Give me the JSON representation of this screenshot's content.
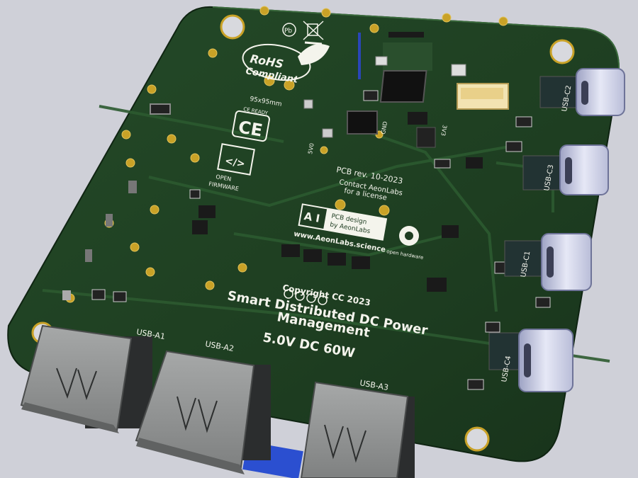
{
  "board": {
    "title_line1": "Smart Distributed DC Power",
    "title_line2": "Management",
    "rating": "5.0V DC 60W",
    "copyright": "Copyright CC 2023",
    "revision": "PCB rev. 10-2023",
    "contact_line1": "Contact AeonLabs",
    "contact_line2": "for a license",
    "size": "95x95mm",
    "rohs_line1": "RoHS",
    "rohs_line2": "Compliant",
    "ce_ready": "CE READY",
    "ce_mark": "CE",
    "open_firmware_line1": "OPEN",
    "open_firmware_line2": "FIRMWARE",
    "logo_letters": "A I",
    "design_line1": "PCB design",
    "design_line2": "by AeonLabs",
    "website": "www.AeonLabs.science",
    "open_hardware": "open hardware",
    "pb_mark": "Pb"
  },
  "connectors": {
    "usb_c": [
      "USB-C2",
      "USB-C3",
      "USB-C1",
      "USB-C4"
    ],
    "usb_a": [
      "USB-A1",
      "USB-A2",
      "USB-A3"
    ]
  },
  "test_points": {
    "five_v": "5V0",
    "gnd": "GND",
    "three_v": "3V3"
  },
  "colors": {
    "background": "#cfd0d8",
    "board": "#1f3d22",
    "silkscreen": "#f4f4ec",
    "gold": "#c9a227"
  }
}
